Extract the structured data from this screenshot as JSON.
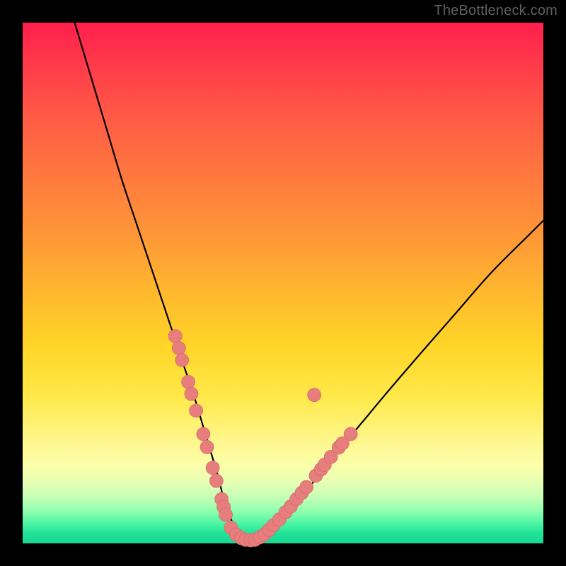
{
  "watermark": "TheBottleneck.com",
  "colors": {
    "background": "#000000",
    "curve": "#000000",
    "dot_fill": "#e77d7c",
    "dot_stroke": "#c96a69"
  },
  "chart_data": {
    "type": "line",
    "title": "",
    "xlabel": "",
    "ylabel": "",
    "xlim": [
      0,
      100
    ],
    "ylim": [
      0,
      100
    ],
    "series": [
      {
        "name": "bottleneck-curve",
        "x": [
          10,
          13,
          16,
          19,
          22,
          25,
          27,
          29,
          31,
          33,
          34.5,
          36,
          37.5,
          38.5,
          39.5,
          40.5,
          41.5,
          42.5,
          43.5,
          45,
          48,
          52,
          56,
          60,
          65,
          70,
          76,
          83,
          90,
          97,
          100
        ],
        "y": [
          100,
          90,
          80,
          70,
          61,
          52,
          46,
          40,
          34,
          28,
          23,
          18,
          13,
          9,
          6,
          3.5,
          2,
          1.2,
          1,
          1,
          3,
          7,
          12,
          17,
          23,
          29,
          36,
          44,
          52,
          59,
          62
        ]
      }
    ],
    "markers": [
      {
        "name": "cluster-dots",
        "x": 29.3,
        "y": 39.8
      },
      {
        "name": "cluster-dots",
        "x": 30.0,
        "y": 37.5
      },
      {
        "name": "cluster-dots",
        "x": 30.6,
        "y": 35.2
      },
      {
        "name": "cluster-dots",
        "x": 31.8,
        "y": 31.0
      },
      {
        "name": "cluster-dots",
        "x": 32.4,
        "y": 28.7
      },
      {
        "name": "cluster-dots",
        "x": 33.3,
        "y": 25.5
      },
      {
        "name": "cluster-dots",
        "x": 34.7,
        "y": 21.0
      },
      {
        "name": "cluster-dots",
        "x": 35.4,
        "y": 18.5
      },
      {
        "name": "cluster-dots",
        "x": 36.5,
        "y": 14.5
      },
      {
        "name": "cluster-dots",
        "x": 37.2,
        "y": 12.0
      },
      {
        "name": "cluster-dots",
        "x": 38.2,
        "y": 8.5
      },
      {
        "name": "cluster-dots",
        "x": 38.6,
        "y": 7.0
      },
      {
        "name": "cluster-dots",
        "x": 39.0,
        "y": 5.5
      },
      {
        "name": "cluster-dots",
        "x": 40.0,
        "y": 3.0
      },
      {
        "name": "cluster-dots",
        "x": 41.0,
        "y": 1.7
      },
      {
        "name": "cluster-dots",
        "x": 42.0,
        "y": 1.0
      },
      {
        "name": "cluster-dots",
        "x": 42.8,
        "y": 0.7
      },
      {
        "name": "cluster-dots",
        "x": 43.8,
        "y": 0.6
      },
      {
        "name": "cluster-dots",
        "x": 44.6,
        "y": 0.7
      },
      {
        "name": "cluster-dots",
        "x": 45.6,
        "y": 1.2
      },
      {
        "name": "cluster-dots",
        "x": 46.5,
        "y": 1.8
      },
      {
        "name": "cluster-dots",
        "x": 47.3,
        "y": 2.6
      },
      {
        "name": "cluster-dots",
        "x": 48.2,
        "y": 3.5
      },
      {
        "name": "cluster-dots",
        "x": 49.3,
        "y": 4.6
      },
      {
        "name": "cluster-dots",
        "x": 50.5,
        "y": 6.0
      },
      {
        "name": "cluster-dots",
        "x": 51.5,
        "y": 7.1
      },
      {
        "name": "cluster-dots",
        "x": 52.6,
        "y": 8.5
      },
      {
        "name": "cluster-dots",
        "x": 53.6,
        "y": 9.7
      },
      {
        "name": "cluster-dots",
        "x": 54.5,
        "y": 10.8
      },
      {
        "name": "cluster-dots",
        "x": 56.3,
        "y": 13.0
      },
      {
        "name": "cluster-dots",
        "x": 57.3,
        "y": 14.2
      },
      {
        "name": "cluster-dots",
        "x": 58.0,
        "y": 15.1
      },
      {
        "name": "cluster-dots",
        "x": 59.2,
        "y": 16.6
      },
      {
        "name": "cluster-dots",
        "x": 60.7,
        "y": 18.4
      },
      {
        "name": "cluster-dots",
        "x": 61.4,
        "y": 19.2
      },
      {
        "name": "cluster-dots",
        "x": 63.0,
        "y": 21.0
      },
      {
        "name": "cluster-dots",
        "x": 56.0,
        "y": 28.5
      }
    ],
    "marker_radius": 1.3
  }
}
